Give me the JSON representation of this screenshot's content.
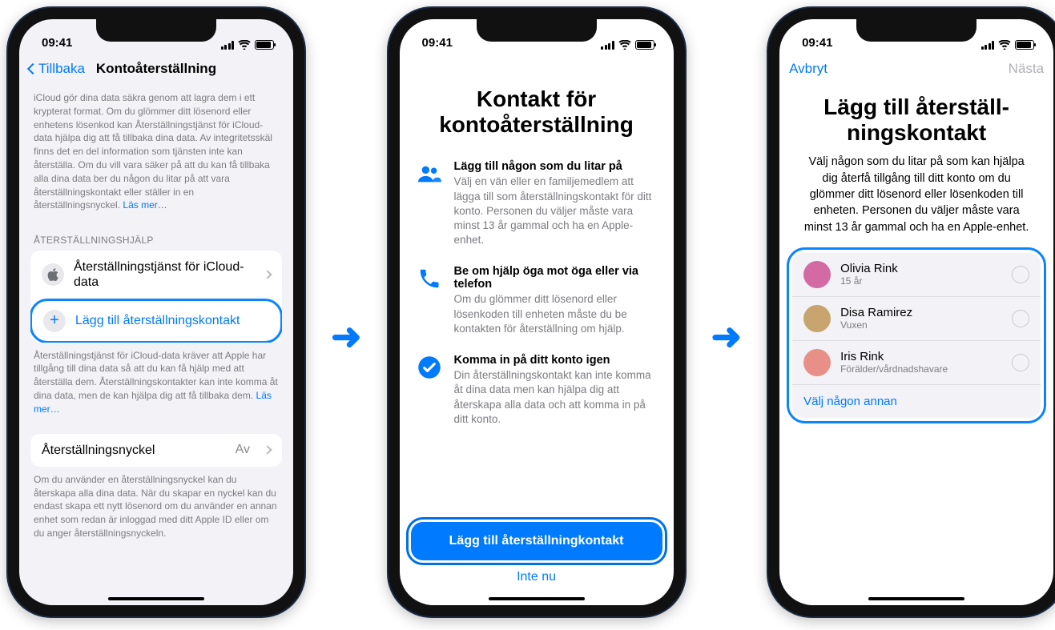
{
  "status_time": "09:41",
  "screen1": {
    "back_label": "Tillbaka",
    "title": "Kontoåterställning",
    "intro_text": "iCloud gör dina data säkra genom att lagra dem i ett krypterat format. Om du glömmer ditt lösenord eller enhetens lösenkod kan Återställningstjänst för iCloud-data hjälpa dig att få tillbaka dina data. Av integritetsskäl finns det en del information som tjänsten inte kan återställa. Om du vill vara säker på att du kan få tillbaka alla dina data ber du någon du litar på att vara återställningskontakt eller ställer in en återställningsnyckel. ",
    "intro_link": "Läs mer…",
    "section_help": "ÅTERSTÄLLNINGSHJÄLP",
    "row_service": "Återställningstjänst för iCloud-data",
    "row_add": "Lägg till återställningskontakt",
    "help_footer": "Återställningstjänst för iCloud-data kräver att Apple har tillgång till dina data så att du kan få hjälp med att återställa dem. Återställningskontakter kan inte komma åt dina data, men de kan hjälpa dig att få tillbaka dem. ",
    "help_footer_link": "Läs mer…",
    "row_key": "Återställningsnyckel",
    "row_key_value": "Av",
    "key_footer": "Om du använder en återställningsnyckel kan du återskapa alla dina data. När du skapar en nyckel kan du endast skapa ett nytt lösenord om du använder en annan enhet som redan är inloggad med ditt Apple ID eller om du anger återställningsnyckeln."
  },
  "screen2": {
    "title": "Kontakt för kontoåterställning",
    "feat1_title": "Lägg till någon som du litar på",
    "feat1_body": "Välj en vän eller en familjemedlem att lägga till som återställningskontakt för ditt konto. Personen du väljer måste vara minst 13 år gammal och ha en Apple-enhet.",
    "feat2_title": "Be om hjälp öga mot öga eller via telefon",
    "feat2_body": "Om du glömmer ditt lösenord eller lösenkoden till enheten måste du be kontakten för återställning om hjälp.",
    "feat3_title": "Komma in på ditt konto igen",
    "feat3_body": "Din återställningskontakt kan inte komma åt dina data men kan hjälpa dig att återskapa alla data och att komma in på ditt konto.",
    "btn_primary": "Lägg till återställningkontakt",
    "btn_link": "Inte nu"
  },
  "screen3": {
    "cancel": "Avbryt",
    "next": "Nästa",
    "title": "Lägg till återställ-ningskontakt",
    "desc": "Välj någon som du litar på som kan hjälpa dig återfå tillgång till ditt konto om du glömmer ditt lösenord eller lösenkoden till enheten. Personen du väljer måste vara minst 13 år gammal och ha en Apple-enhet.",
    "contacts": [
      {
        "name": "Olivia Rink",
        "sub": "15 år",
        "color": "#d46aa3"
      },
      {
        "name": "Disa Ramirez",
        "sub": "Vuxen",
        "color": "#c8a56e"
      },
      {
        "name": "Iris Rink",
        "sub": "Förälder/vårdnadshavare",
        "color": "#e89088"
      }
    ],
    "choose_other": "Välj någon annan"
  }
}
